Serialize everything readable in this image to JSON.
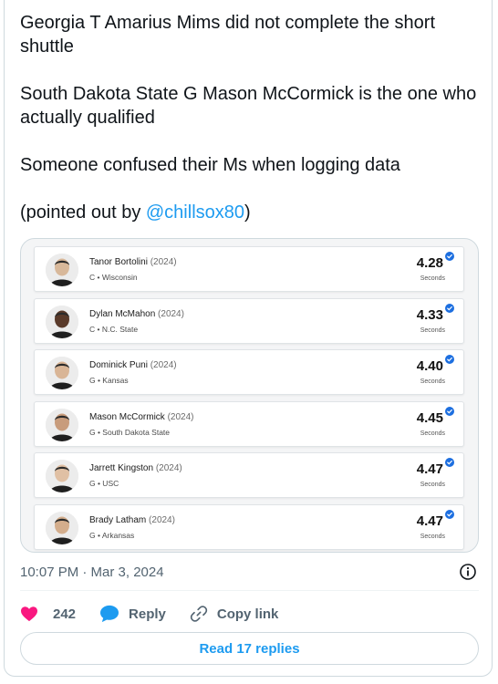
{
  "tweet": {
    "paragraphs": [
      "Georgia T Amarius Mims did not complete the short shuttle",
      "South Dakota State G Mason McCormick is the one who actually qualified",
      "Someone confused their Ms when logging data"
    ],
    "credit_prefix": "(pointed out by ",
    "mention": "@chillsox80",
    "credit_suffix": ")"
  },
  "players": [
    {
      "name": "Tanor Bortolini",
      "year": "(2024)",
      "meta": "C • Wisconsin",
      "time": "4.28",
      "unit": "Seconds"
    },
    {
      "name": "Dylan McMahon",
      "year": "(2024)",
      "meta": "C • N.C. State",
      "time": "4.33",
      "unit": "Seconds"
    },
    {
      "name": "Dominick Puni",
      "year": "(2024)",
      "meta": "G • Kansas",
      "time": "4.40",
      "unit": "Seconds"
    },
    {
      "name": "Mason McCormick",
      "year": "(2024)",
      "meta": "G • South Dakota State",
      "time": "4.45",
      "unit": "Seconds"
    },
    {
      "name": "Jarrett Kingston",
      "year": "(2024)",
      "meta": "G • USC",
      "time": "4.47",
      "unit": "Seconds"
    },
    {
      "name": "Brady Latham",
      "year": "(2024)",
      "meta": "G • Arkansas",
      "time": "4.47",
      "unit": "Seconds"
    }
  ],
  "timestamp": "10:07 PM · Mar 3, 2024",
  "actions": {
    "like_count": "242",
    "reply_label": "Reply",
    "copy_label": "Copy link"
  },
  "read_replies": "Read 17 replies",
  "colors": {
    "accent": "#1d9bf0",
    "like": "#f91880",
    "muted": "#536471"
  },
  "icons": [
    "info-icon",
    "heart-icon",
    "reply-icon",
    "link-icon",
    "verified-icon"
  ]
}
